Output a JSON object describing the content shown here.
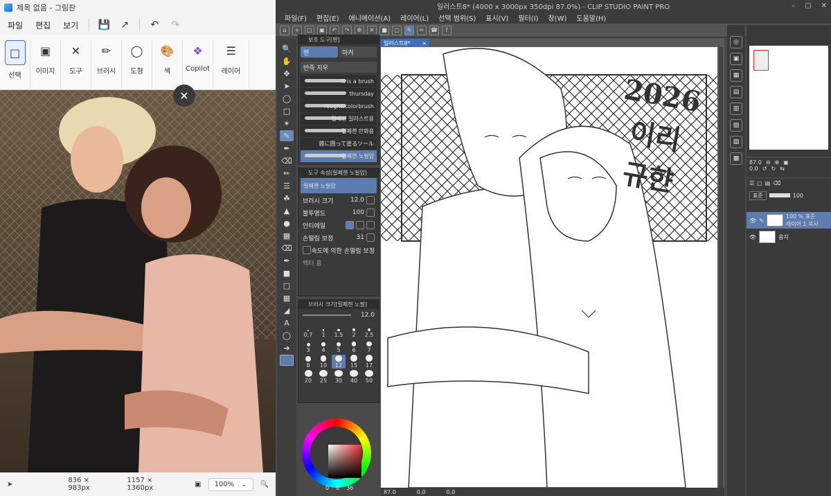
{
  "paint": {
    "title": "제목 없음 - 그림판",
    "menu": [
      "파일",
      "편집",
      "보기"
    ],
    "ribbon": [
      {
        "label": "선택",
        "icon": "select-icon"
      },
      {
        "label": "이미지",
        "icon": "image-icon"
      },
      {
        "label": "도구",
        "icon": "tools-icon"
      },
      {
        "label": "브러시",
        "icon": "brush-icon"
      },
      {
        "label": "도형",
        "icon": "shapes-icon"
      },
      {
        "label": "색",
        "icon": "palette-icon"
      },
      {
        "label": "Copilot",
        "icon": "copilot-icon"
      },
      {
        "label": "레이어",
        "icon": "layers-icon"
      }
    ],
    "status": {
      "selection_size": "836 × 983px",
      "image_size": "1157 × 1360px",
      "zoom": "100%"
    }
  },
  "csp": {
    "title": "일러스트8* (4000 x 3000px 350dpi 87.0%) - CLIP STUDIO PAINT PRO",
    "menu": [
      "파일(F)",
      "편집(E)",
      "애니메이션(A)",
      "레이어(L)",
      "선택 범위(S)",
      "표시(V)",
      "필터(I)",
      "창(W)",
      "도움말(H)"
    ],
    "subtool_header": "보조 도구[펜]",
    "subtool_tabs": [
      "펜",
      "마커"
    ],
    "subtool_group": "반죽 지우",
    "brushes": [
      "it is a brush",
      "thursday",
      "rough&colorbrush",
      "릴페챈 일러스트용",
      "릴페챈 만화용",
      "雑に囲って塗るツール",
      "릴페챈 노필압"
    ],
    "tool_prop_header": "도구 속성[릴페챈 노필압]",
    "tool_prop_name": "릴페챈 노필압",
    "props": [
      {
        "label": "브러시 크기",
        "value": "12.0"
      },
      {
        "label": "불투명도",
        "value": "100"
      },
      {
        "label": "안티에일",
        "value": ""
      },
      {
        "label": "손떨림 보정",
        "value": "31"
      },
      {
        "label": "속도에 의한 손떨림 보정",
        "value": ""
      },
      {
        "label": "벡터 흡",
        "value": ""
      }
    ],
    "brushsize_header": "브러시 크기[릴페챈 노필]",
    "brushsize_value": "12.0",
    "sizes": [
      "0.7",
      "1",
      "1.5",
      "2",
      "2.5",
      "3",
      "4",
      "5",
      "6",
      "7",
      "8",
      "10",
      "12",
      "15",
      "17",
      "20",
      "25",
      "30",
      "40",
      "50"
    ],
    "doc_tab": "일러스트8*",
    "canvas_text": [
      "2026",
      "이리",
      "규햔"
    ],
    "doc_status": {
      "zoom": "87.0",
      "x": "0.0",
      "y": "0.0"
    },
    "color_values": {
      "v1": "0",
      "v2": "0",
      "v3": "36"
    },
    "nav": {
      "zoom": "87.0",
      "rotation": "0.0"
    },
    "layer_blend": "표준",
    "layer_opacity": "100",
    "layers": [
      {
        "name": "100 % 표준\n레이어 1 복사",
        "active": true
      },
      {
        "name": "용지",
        "active": false
      }
    ]
  }
}
